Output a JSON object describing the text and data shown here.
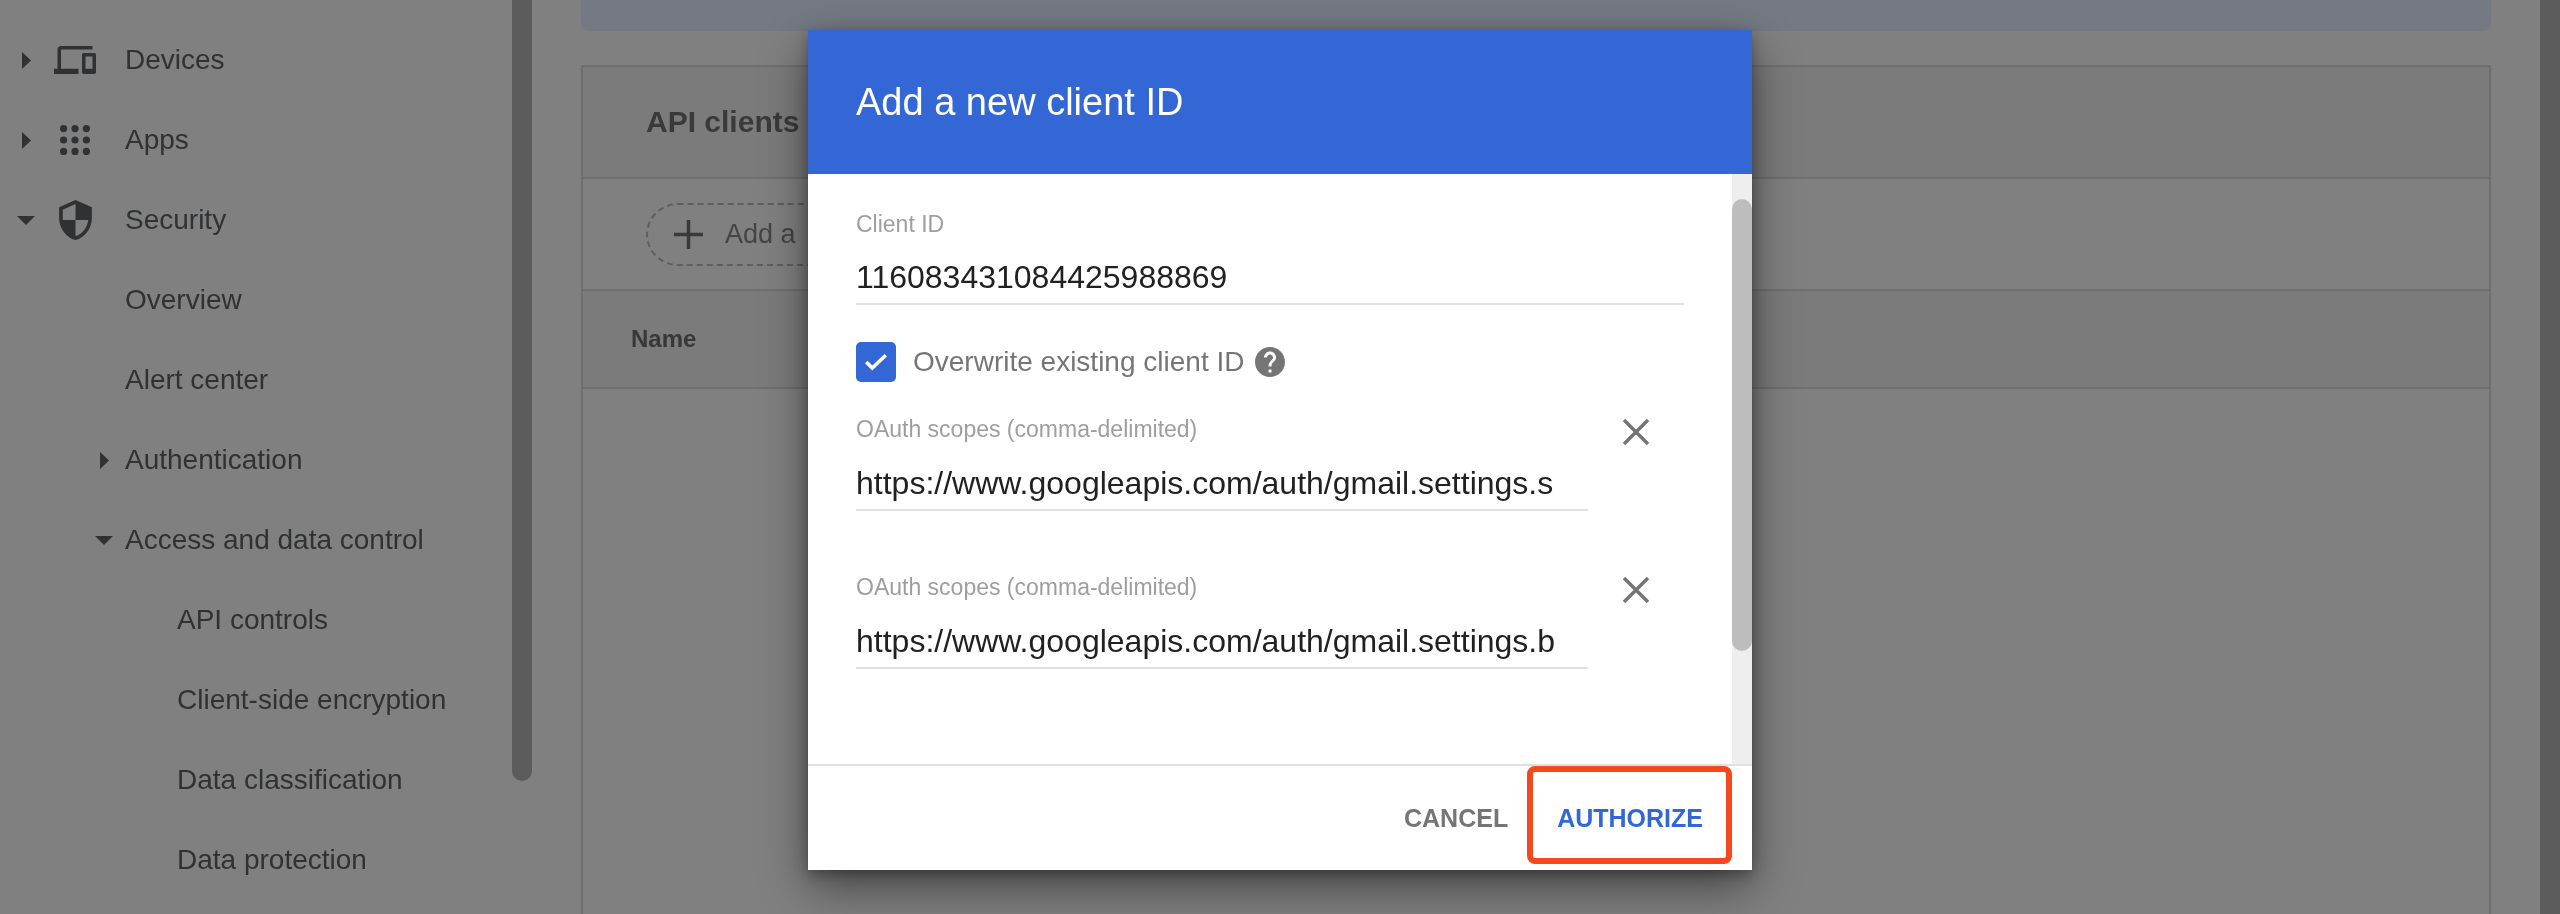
{
  "sidebar": {
    "items": [
      {
        "label": "Devices",
        "kind": "group",
        "expanded": false
      },
      {
        "label": "Apps",
        "kind": "group",
        "expanded": false
      },
      {
        "label": "Security",
        "kind": "group",
        "expanded": true,
        "children": [
          {
            "label": "Overview",
            "kind": "page"
          },
          {
            "label": "Alert center",
            "kind": "page"
          },
          {
            "label": "Authentication",
            "kind": "group",
            "expanded": false
          },
          {
            "label": "Access and data control",
            "kind": "group",
            "expanded": true,
            "children": [
              {
                "label": "API controls",
                "kind": "page"
              },
              {
                "label": "Client-side encryption",
                "kind": "page"
              },
              {
                "label": "Data classification",
                "kind": "page"
              },
              {
                "label": "Data protection",
                "kind": "page"
              }
            ]
          }
        ]
      }
    ]
  },
  "api_clients": {
    "title": "API clients",
    "filter_button": "Add a",
    "columns": [
      "Name"
    ]
  },
  "dialog": {
    "title": "Add a new client ID",
    "client_id": {
      "label": "Client ID",
      "value": "116083431084425988869"
    },
    "overwrite": {
      "label": "Overwrite existing client ID",
      "checked": true
    },
    "scopes": [
      {
        "label": "OAuth scopes (comma-delimited)",
        "value": "https://www.googleapis.com/auth/gmail.settings.s"
      },
      {
        "label": "OAuth scopes (comma-delimited)",
        "value": "https://www.googleapis.com/auth/gmail.settings.b"
      }
    ],
    "buttons": [
      {
        "label": "CANCEL",
        "kind": "secondary",
        "highlighted": false
      },
      {
        "label": "AUTHORIZE",
        "kind": "primary",
        "highlighted": true
      }
    ]
  }
}
